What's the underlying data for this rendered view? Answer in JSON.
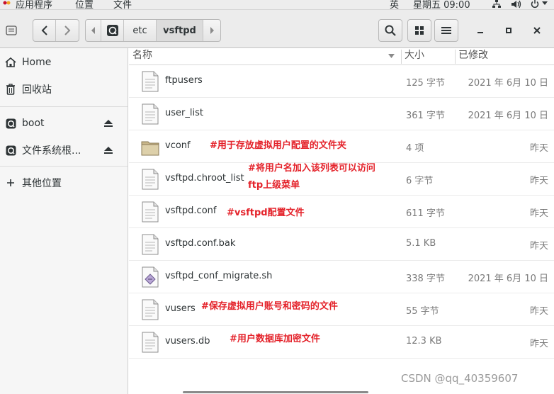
{
  "topbar": {
    "applications": "应用程序",
    "places": "位置",
    "files": "文件",
    "input_method": "英",
    "clock": "星期五 09:00"
  },
  "path": [
    "etc",
    "vsftpd"
  ],
  "sidebar": {
    "items": [
      {
        "label": "Home",
        "icon": "home-icon"
      },
      {
        "label": "回收站",
        "icon": "trash-icon"
      },
      {
        "label": "boot",
        "icon": "drive-icon"
      },
      {
        "label": "文件系统根...",
        "icon": "drive-icon"
      },
      {
        "label": "其他位置",
        "icon": "plus-icon"
      }
    ]
  },
  "columns": {
    "name": "名称",
    "size": "大小",
    "modified": "已修改"
  },
  "files": [
    {
      "name": "ftpusers",
      "size": "125 字节",
      "modified": "2021 年 6月 10 日",
      "type": "text"
    },
    {
      "name": "user_list",
      "size": "361 字节",
      "modified": "2021 年 6月 10 日",
      "type": "text"
    },
    {
      "name": "vconf",
      "size": "4 项",
      "modified": "昨天",
      "type": "folder",
      "note": "#用于存放虚拟用户配置的文件夹"
    },
    {
      "name": "vsftpd.chroot_list",
      "size": "6 字节",
      "modified": "昨天",
      "type": "text",
      "note": "#将用户名加入该列表可以访问",
      "note2": "ftp上级菜单"
    },
    {
      "name": "vsftpd.conf",
      "size": "611 字节",
      "modified": "昨天",
      "type": "text",
      "note": "#vsftpd配置文件"
    },
    {
      "name": "vsftpd.conf.bak",
      "size": "5.1 KB",
      "modified": "昨天",
      "type": "text"
    },
    {
      "name": "vsftpd_conf_migrate.sh",
      "size": "338 字节",
      "modified": "2021 年 6月 10 日",
      "type": "script"
    },
    {
      "name": "vusers",
      "size": "55 字节",
      "modified": "昨天",
      "type": "text",
      "note": "#保存虚拟用户账号和密码的文件"
    },
    {
      "name": "vusers.db",
      "size": "12.3 KB",
      "modified": "昨天",
      "type": "text",
      "note": "#用户数据库加密文件"
    }
  ],
  "watermark": "CSDN @qq_40359607",
  "colors": {
    "annotation": "#e4222a",
    "headerbar": "#ececec",
    "sidebar": "#f6f6f6"
  }
}
